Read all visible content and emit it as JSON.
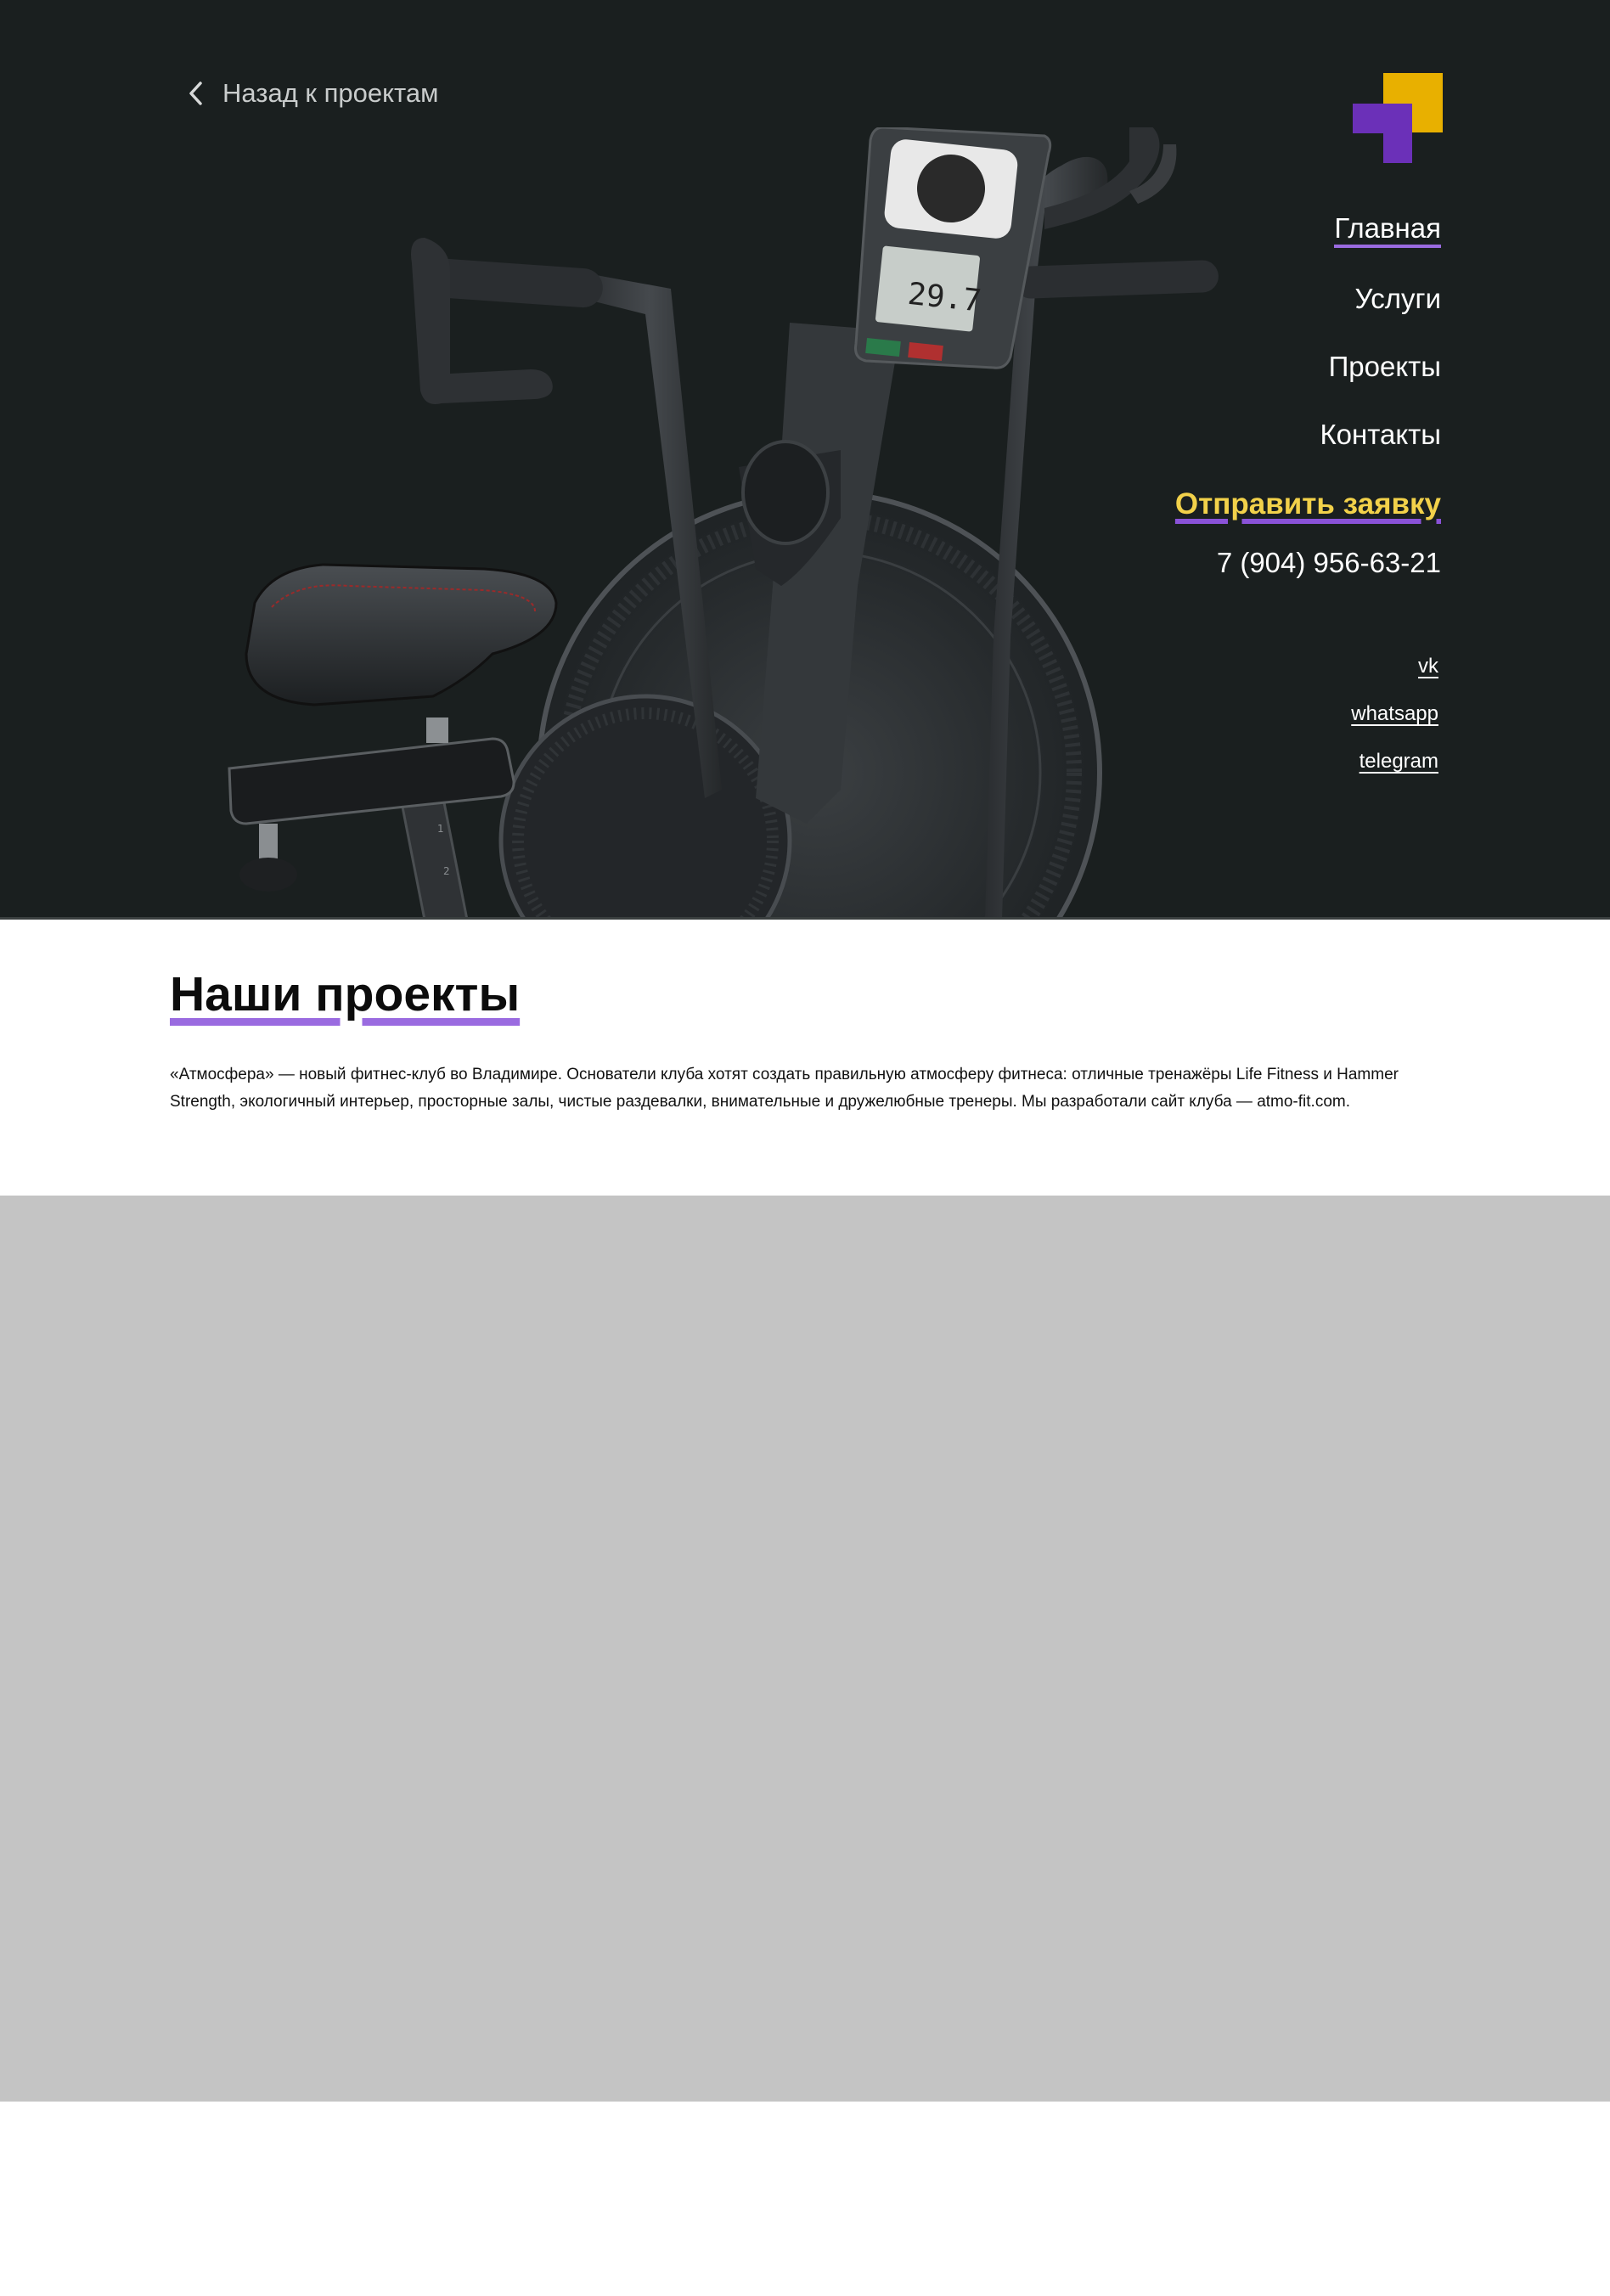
{
  "header": {
    "back_label": "Назад к проектам"
  },
  "nav": {
    "items": [
      {
        "label": "Главная",
        "active": true
      },
      {
        "label": "Услуги",
        "active": false
      },
      {
        "label": "Проекты",
        "active": false
      },
      {
        "label": "Контакты",
        "active": false
      }
    ],
    "cta_label": "Отправить заявку",
    "phone": "7 (904) 956-63-21"
  },
  "socials": [
    "vk",
    "whatsapp",
    "telegram"
  ],
  "project": {
    "title": "Наши проекты",
    "description": "«Атмосфера» — новый фитнес-клуб во Владимире. Основатели клуба хотят создать правильную атмосферу фитнеса: отличные тренажёры Life Fitness и Hammer Strength, экологичный интерьер, просторные залы, чистые раздевалки, внимательные и дружелюбные тренеры. Мы разработали сайт клуба — atmo-fit.com."
  },
  "colors": {
    "hero_bg": "#1a1f1f",
    "accent_purple": "#9a6be0",
    "accent_yellow": "#f2d14a",
    "logo_purple": "#6b30b8",
    "logo_yellow": "#e8b000",
    "placeholder_gray": "#c4c4c4"
  },
  "icons": {
    "back": "chevron-left-icon",
    "logo": "company-logo"
  }
}
